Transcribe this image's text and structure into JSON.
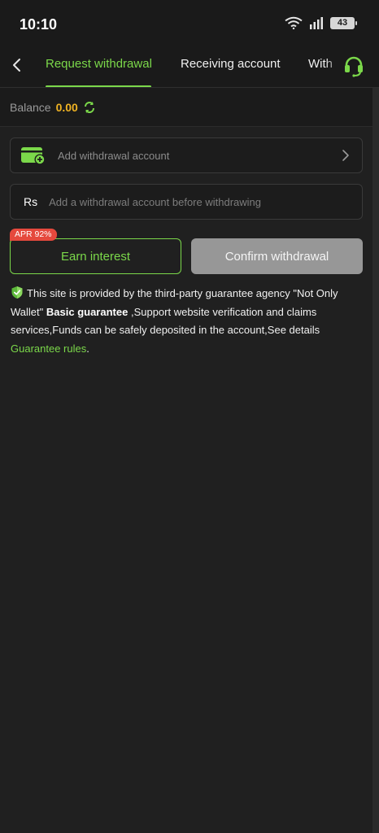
{
  "status_bar": {
    "time": "10:10",
    "battery": "43"
  },
  "nav": {
    "tabs": [
      {
        "label": "Request withdrawal",
        "active": true
      },
      {
        "label": "Receiving account",
        "active": false
      },
      {
        "label": "With",
        "active": false
      }
    ],
    "accent_color": "#7bd84a"
  },
  "balance": {
    "label": "Balance",
    "value": "0.00"
  },
  "account_field": {
    "placeholder": "Add withdrawal account"
  },
  "amount_field": {
    "currency": "Rs",
    "placeholder": "Add a withdrawal account before withdrawing"
  },
  "actions": {
    "apr_badge": "APR 92%",
    "earn_label": "Earn interest",
    "confirm_label": "Confirm withdrawal"
  },
  "guarantee": {
    "text_1": "This site is provided by the third-party guarantee agency \"Not Only Wallet\"",
    "bold": "Basic guarantee",
    "text_2": ",Support website verification and claims services,Funds can be safely deposited in the account,See details",
    "link": "Guarantee rules",
    "end": "."
  }
}
